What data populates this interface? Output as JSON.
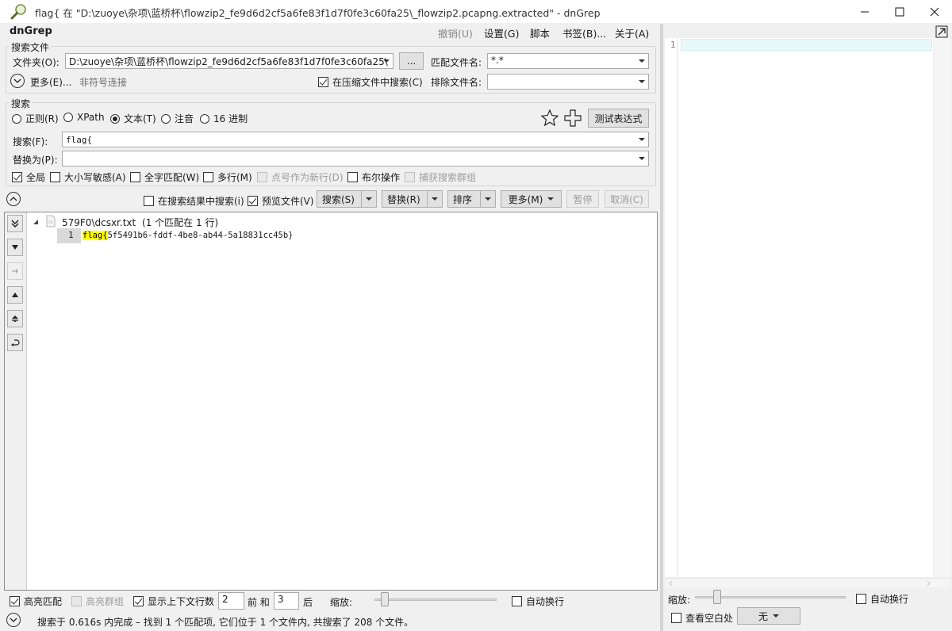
{
  "window": {
    "title": "flag{ 在 \"D:\\zuoye\\杂项\\蓝桥杯\\flowzip2_fe9d6d2cf5a6fe83f1d7f0fe3c60fa25\\_flowzip2.pcapng.extracted\" - dnGrep"
  },
  "app": {
    "name": "dnGrep"
  },
  "menu": {
    "undo": "撤销(U)",
    "settings": "设置(G)",
    "script": "脚本",
    "bookmarks": "书签(B)...",
    "about": "关于(A)"
  },
  "search_files": {
    "group_title": "搜索文件",
    "folder_label": "文件夹(O):",
    "folder_value": "D:\\zuoye\\杂项\\蓝桥杯\\flowzip2_fe9d6d2cf5a6fe83f1d7f0fe3c60fa25\\",
    "browse_label": "...",
    "match_files_label": "匹配文件名:",
    "match_files_value": "*.*",
    "more_label": "更多(E)...",
    "symlink_label": "非符号连接",
    "search_archives_label": "在压缩文件中搜索(C)",
    "search_archives_checked": true,
    "exclude_label": "排除文件名:",
    "exclude_value": ""
  },
  "search": {
    "group_title": "搜索",
    "types": [
      {
        "label": "正则(R)",
        "checked": false
      },
      {
        "label": "XPath",
        "checked": false
      },
      {
        "label": "文本(T)",
        "checked": true
      },
      {
        "label": "注音",
        "checked": false
      },
      {
        "label": "16 进制",
        "checked": false
      }
    ],
    "test_expression_label": "测试表达式",
    "search_label": "搜索(F):",
    "search_value": "flag{",
    "replace_label": "替换为(P):",
    "replace_value": "",
    "options": [
      {
        "label": "全局",
        "checked": true,
        "disabled": false
      },
      {
        "label": "大小写敏感(A)",
        "checked": false,
        "disabled": false
      },
      {
        "label": "全字匹配(W)",
        "checked": false,
        "disabled": false
      },
      {
        "label": "多行(M)",
        "checked": false,
        "disabled": false
      },
      {
        "label": "点号作为新行(D)",
        "checked": false,
        "disabled": true
      },
      {
        "label": "布尔操作",
        "checked": false,
        "disabled": false
      },
      {
        "label": "捕获搜索群组",
        "checked": false,
        "disabled": true
      }
    ]
  },
  "toolbar": {
    "search_in_results_label": "在搜索结果中搜索(i)",
    "search_in_results_checked": false,
    "preview_label": "预览文件(V)",
    "preview_checked": true,
    "search_button": "搜索(S)",
    "replace_button": "替换(R)",
    "sort_button": "排序",
    "more_button": "更多(M)",
    "pause_button": "暂停",
    "cancel_button": "取消(C)"
  },
  "results": {
    "file_name": "579F0\\dcsxr.txt",
    "file_summary": "(1 个匹配在 1 行)",
    "lines": [
      {
        "number": "1",
        "match": "flag{",
        "rest": "5f5491b6-fddf-4be8-ab44-5a18831cc45b}"
      }
    ]
  },
  "bottom_bar": {
    "highlight_matches_label": "高亮匹配",
    "highlight_matches_checked": true,
    "highlight_groups_label": "高亮群组",
    "highlight_groups_checked": false,
    "show_context_label": "显示上下文行数",
    "show_context_checked": true,
    "before_value": "2",
    "before_label": "前 和",
    "after_value": "3",
    "after_label": "后",
    "zoom_label": "缩放:",
    "word_wrap_label": "自动换行",
    "word_wrap_checked": false
  },
  "status": {
    "text": "搜索于 0.616s 内完成 – 找到 1 个匹配项, 它们位于 1 个文件内, 共搜索了 208 个文件。"
  },
  "preview": {
    "line_number": "1",
    "zoom_label": "缩放:",
    "word_wrap_label": "自动换行",
    "word_wrap_checked": false,
    "show_whitespace_label": "查看空白处",
    "show_whitespace_checked": false,
    "syntax_value": "无"
  },
  "colors": {
    "highlight": "#ffff00",
    "preview_line": "#e8f8fb"
  }
}
